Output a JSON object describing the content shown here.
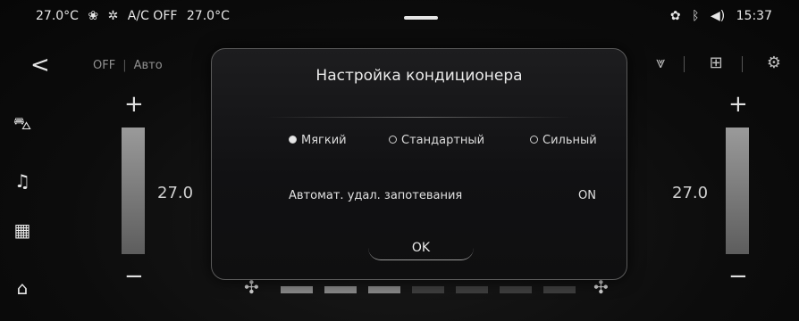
{
  "status": {
    "left_temp": "27.0°C",
    "ac_status": "A/C OFF",
    "right_temp": "27.0°C",
    "time": "15:37",
    "icons": [
      "fan-level-icon",
      "ac-icon",
      "settings-cog-icon",
      "bluetooth-icon",
      "volume-icon"
    ]
  },
  "topbar": {
    "modes": [
      "OFF",
      "Авто"
    ]
  },
  "climate": {
    "left_temp": "27.0",
    "right_temp": "27.0",
    "fan_level": 3,
    "fan_segments": 7
  },
  "dialog": {
    "title": "Настройка кондиционера",
    "options": [
      {
        "label": "Мягкий",
        "selected": true
      },
      {
        "label": "Стандартный",
        "selected": false
      },
      {
        "label": "Сильный",
        "selected": false
      }
    ],
    "auto_label": "Автомат. удал. запотевания",
    "auto_value": "ON",
    "ok_label": "OK"
  }
}
